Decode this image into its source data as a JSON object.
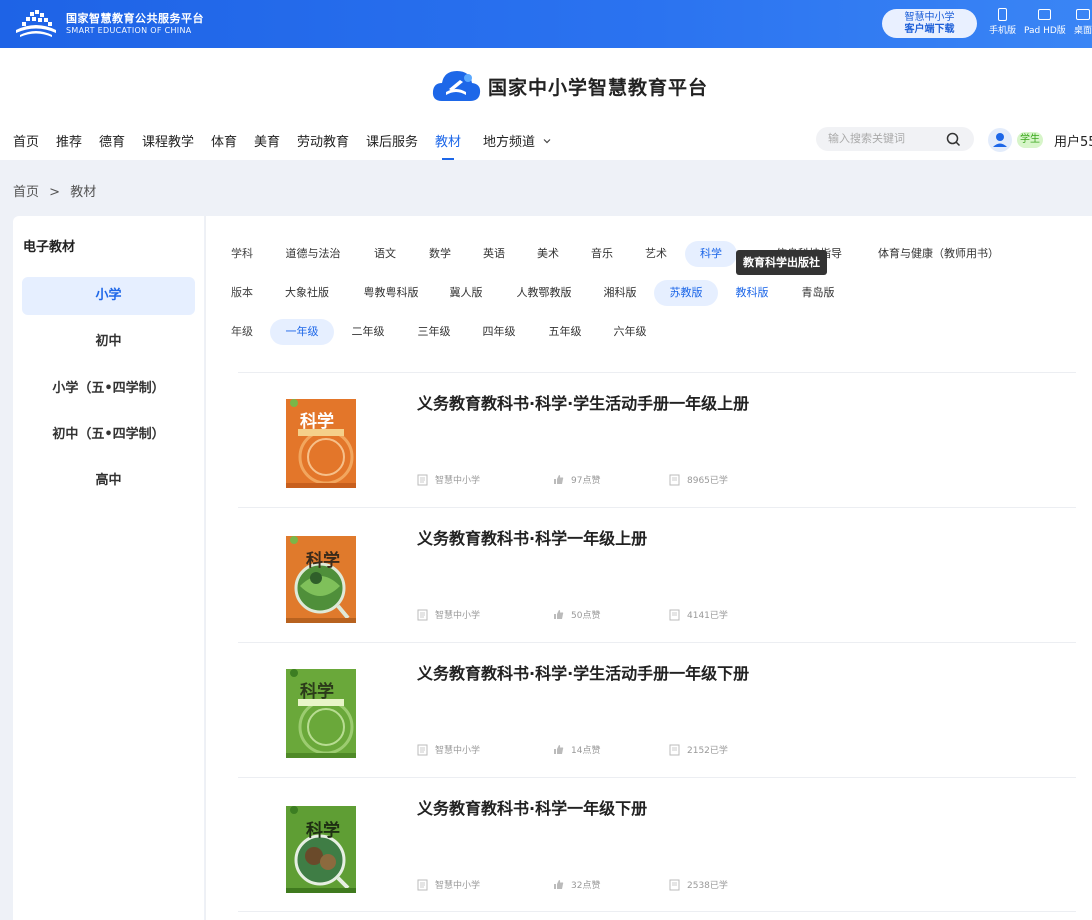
{
  "topbar": {
    "brand_cn": "国家智慧教育公共服务平台",
    "brand_en": "SMART EDUCATION OF CHINA",
    "download_line1": "智慧中小学",
    "download_line2": "客户端下载",
    "devices": [
      {
        "label": "手机版",
        "icon": "phone-icon"
      },
      {
        "label": "Pad HD版",
        "icon": "tablet-icon"
      },
      {
        "label": "桌面",
        "icon": "desktop-icon"
      }
    ]
  },
  "header": {
    "site_title": "国家中小学智慧教育平台",
    "nav": [
      {
        "label": "首页"
      },
      {
        "label": "推荐"
      },
      {
        "label": "德育"
      },
      {
        "label": "课程教学"
      },
      {
        "label": "体育"
      },
      {
        "label": "美育"
      },
      {
        "label": "劳动教育"
      },
      {
        "label": "课后服务"
      },
      {
        "label": "教材",
        "active": true
      },
      {
        "label": "地方频道"
      }
    ],
    "search_placeholder": "输入搜索关键词",
    "role_badge": "学生",
    "username": "用户55"
  },
  "breadcrumb": {
    "home": "首页",
    "separator": ">",
    "current": "教材"
  },
  "sidebar": {
    "title": "电子教材",
    "items": [
      {
        "label": "小学",
        "active": true
      },
      {
        "label": "初中"
      },
      {
        "label": "小学（五•四学制）"
      },
      {
        "label": "初中（五•四学制）"
      },
      {
        "label": "高中"
      }
    ]
  },
  "filters": {
    "subject": {
      "label": "学科",
      "options": [
        "道德与法治",
        "语文",
        "数学",
        "英语",
        "音乐",
        "美术",
        "艺术",
        "科学",
        "信息科技指导",
        "体育与健康（教师用书）"
      ],
      "selected": "科学"
    },
    "edition": {
      "label": "版本",
      "options": [
        "大象社版",
        "粤教粤科版",
        "冀人版",
        "人教鄂教版",
        "湘科版",
        "苏教版",
        "教科版",
        "青岛版"
      ],
      "selected": "苏教版",
      "hovered": "教科版"
    },
    "grade": {
      "label": "年级",
      "options": [
        "一年级",
        "二年级",
        "三年级",
        "四年级",
        "五年级",
        "六年级"
      ],
      "selected": "一年级"
    },
    "tooltip": "教育科学出版社"
  },
  "books": [
    {
      "title": "义务教育教科书·科学·学生活动手册一年级上册",
      "source": "智慧中小学",
      "likes": "97点赞",
      "learners": "8965已学",
      "cover_color": "#e3762a",
      "cover_text": "科学"
    },
    {
      "title": "义务教育教科书·科学一年级上册",
      "source": "智慧中小学",
      "likes": "50点赞",
      "learners": "4141已学",
      "cover_color": "#e07a2c",
      "cover_text": "科学"
    },
    {
      "title": "义务教育教科书·科学·学生活动手册一年级下册",
      "source": "智慧中小学",
      "likes": "14点赞",
      "learners": "2152已学",
      "cover_color": "#6aa83a",
      "cover_text": "科学"
    },
    {
      "title": "义务教育教科书·科学一年级下册",
      "source": "智慧中小学",
      "likes": "32点赞",
      "learners": "2538已学",
      "cover_color": "#5f9e34",
      "cover_text": "科学"
    }
  ],
  "colors": {
    "primary": "#1d67e8",
    "selected_bg": "#e6efff",
    "role_badge_bg": "#d7f5c9"
  }
}
